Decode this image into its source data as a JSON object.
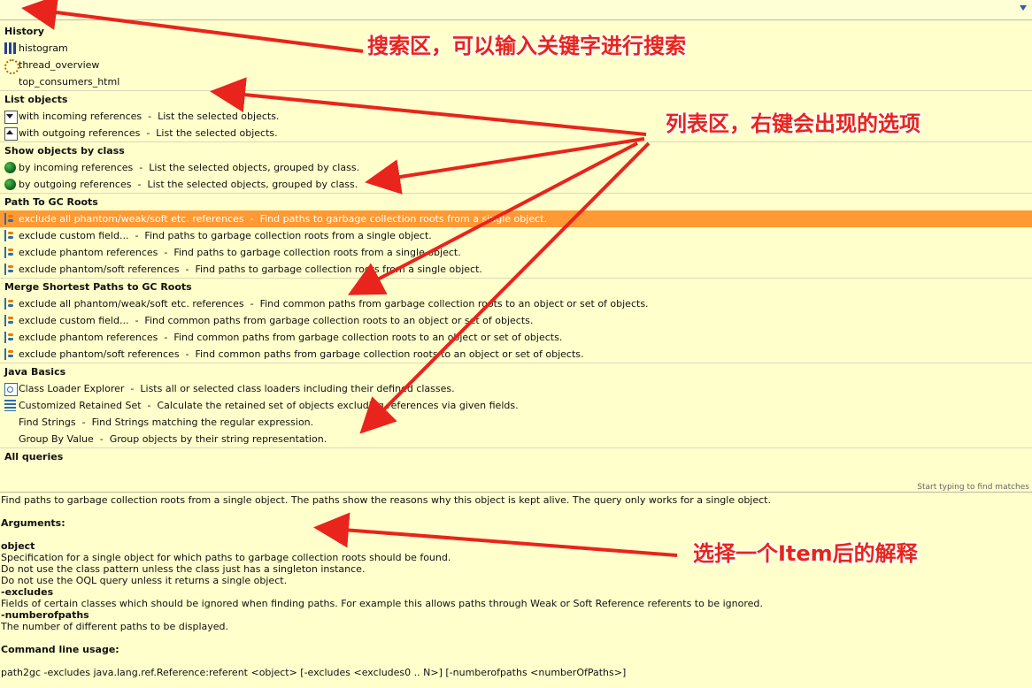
{
  "search": {
    "value": "",
    "placeholder": ""
  },
  "hint": "Start typing to find matches",
  "sections": [
    {
      "title": "History",
      "items": [
        {
          "icon": "histogram-icon",
          "name": "histogram",
          "desc": ""
        },
        {
          "icon": "gear-icon",
          "name": "thread_overview",
          "desc": ""
        },
        {
          "icon": "",
          "name": "top_consumers_html",
          "desc": ""
        }
      ]
    },
    {
      "title": "List objects",
      "items": [
        {
          "icon": "incoming-references-icon",
          "name": "with incoming references",
          "desc": "List the selected objects."
        },
        {
          "icon": "outgoing-references-icon",
          "name": "with outgoing references",
          "desc": "List the selected objects."
        }
      ]
    },
    {
      "title": "Show objects by class",
      "items": [
        {
          "icon": "class-incoming-icon",
          "name": "by incoming references",
          "desc": "List the selected objects, grouped by class."
        },
        {
          "icon": "class-outgoing-icon",
          "name": "by outgoing references",
          "desc": "List the selected objects, grouped by class."
        }
      ]
    },
    {
      "title": "Path To GC Roots",
      "items": [
        {
          "icon": "gc-path-icon",
          "name": "exclude all phantom/weak/soft etc. references",
          "desc": "Find paths to garbage collection roots from a single object.",
          "selected": true
        },
        {
          "icon": "gc-path-icon",
          "name": "exclude custom field...",
          "desc": "Find paths to garbage collection roots from a single object."
        },
        {
          "icon": "gc-path-icon",
          "name": "exclude phantom references",
          "desc": "Find paths to garbage collection roots from a single object."
        },
        {
          "icon": "gc-path-icon",
          "name": "exclude phantom/soft references",
          "desc": "Find paths to garbage collection roots from a single object."
        }
      ]
    },
    {
      "title": "Merge Shortest Paths to GC Roots",
      "items": [
        {
          "icon": "merge-paths-icon",
          "name": "exclude all phantom/weak/soft etc. references",
          "desc": "Find common paths from garbage collection roots to an object or set of objects."
        },
        {
          "icon": "merge-paths-icon",
          "name": "exclude custom field...",
          "desc": "Find common paths from garbage collection roots to an object or set of objects."
        },
        {
          "icon": "merge-paths-icon",
          "name": "exclude phantom references",
          "desc": "Find common paths from garbage collection roots to an object or set of objects."
        },
        {
          "icon": "merge-paths-icon",
          "name": "exclude phantom/soft references",
          "desc": "Find common paths from garbage collection roots to an object or set of objects."
        }
      ]
    },
    {
      "title": "Java Basics",
      "items": [
        {
          "icon": "class-loader-icon",
          "name": "Class Loader Explorer",
          "desc": "Lists all or selected class loaders including their defined classes."
        },
        {
          "icon": "retained-set-icon",
          "name": "Customized Retained Set",
          "desc": "Calculate the retained set of objects excluding references via given fields."
        },
        {
          "icon": "",
          "name": "Find Strings",
          "desc": "Find Strings matching the regular expression."
        },
        {
          "icon": "",
          "name": "Group By Value",
          "desc": "Group objects by their string representation."
        }
      ]
    },
    {
      "title": "All queries",
      "items": []
    }
  ],
  "description": {
    "summary": "Find paths to garbage collection roots from a single object. The paths show the reasons why this object is kept alive. The query only works for a single object.",
    "arguments_label": "Arguments:",
    "arg1_name": "object",
    "arg1_lines": [
      "Specification for a single object for which paths to garbage collection roots should be found.",
      "Do not use the class pattern unless the class just has a singleton instance.",
      "Do not use the OQL query unless it returns a single object."
    ],
    "arg2_name": "-excludes",
    "arg2_line": "Fields of certain classes which should be ignored when finding paths. For example this allows paths through Weak or Soft Reference referents to be ignored.",
    "arg3_name": "-numberofpaths",
    "arg3_line": "The number of different paths to be displayed.",
    "usage_label": "Command line usage:",
    "usage": "path2gc -excludes java.lang.ref.Reference:referent <object> [-excludes <excludes0 .. N>] [-numberofpaths <numberOfPaths>]"
  },
  "annotations": {
    "search_note": "搜索区，可以输入关键字进行搜索",
    "list_note": "列表区，右键会出现的选项",
    "desc_note": "选择一个Item后的解释",
    "color": "#e8241c"
  },
  "colors": {
    "background": "#ffffcc",
    "selection": "#ff9933"
  }
}
